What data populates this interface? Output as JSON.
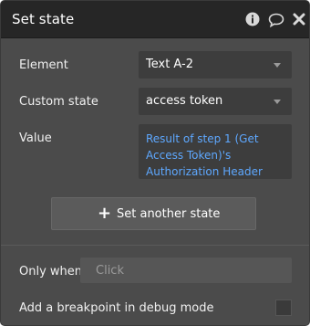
{
  "window": {
    "title": "Set state"
  },
  "header_icons": [
    "info-icon",
    "comment-icon",
    "close-icon"
  ],
  "element_row": {
    "label": "Element",
    "value": "Text A-2"
  },
  "custom_state_row": {
    "label": "Custom state",
    "value": "access token"
  },
  "value_row": {
    "label": "Value",
    "expression": "Result of step 1 (Get Access Token)'s Authorization Header"
  },
  "set_another_button": {
    "icon": "plus-icon",
    "label": "Set another state"
  },
  "only_when": {
    "label": "Only when",
    "placeholder": "Click"
  },
  "breakpoint": {
    "label": "Add a breakpoint in debug mode",
    "checked": false
  },
  "colors": {
    "panel_bg": "#4b4b4b",
    "header_bg": "#262626",
    "field_bg": "#3d3d3d",
    "expression_text": "#5ea8ff"
  }
}
